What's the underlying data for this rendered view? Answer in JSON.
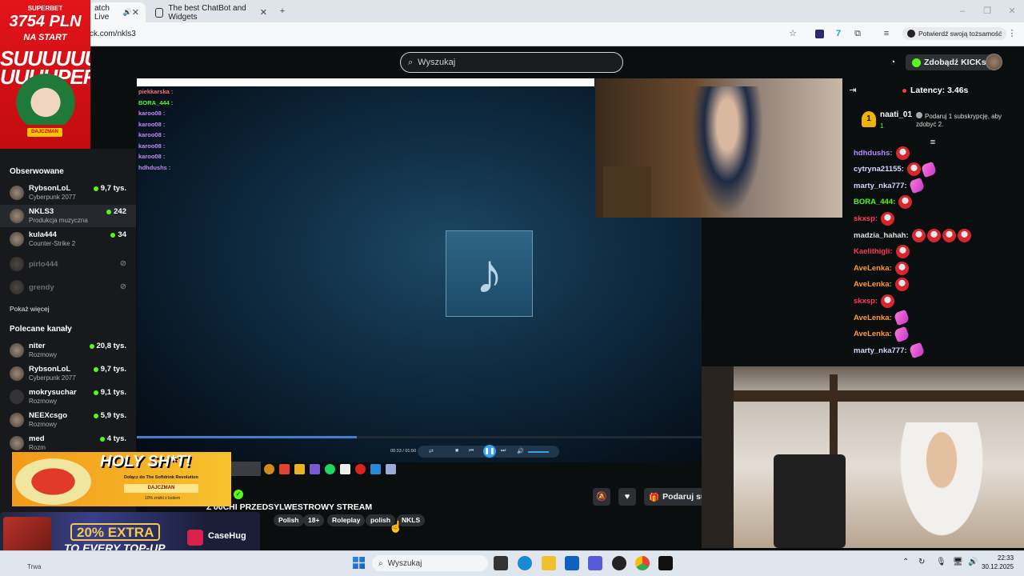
{
  "browser": {
    "tab1_label": "atch Live",
    "tab2_label": "The best ChatBot and Widgets",
    "url": "ck.com/nkls3",
    "verify_label": "Potwierdź swoją tożsamość"
  },
  "left_ad": {
    "brand": "SUPERBET",
    "amount": "3754 PLN",
    "tagline": "NA START",
    "headline": "SUUUUUU UUUUPER",
    "logo": "DAJCZMAN"
  },
  "header": {
    "search_placeholder": "Wyszukaj",
    "kicks_label": "Zdobądź KICKs"
  },
  "sidebar": {
    "followed_title": "Obserwowane",
    "followed": [
      {
        "name": "RybsonLoL",
        "category": "Cyberpunk 2077",
        "viewers": "9,7 tys.",
        "live": true
      },
      {
        "name": "NKLS3",
        "category": "Produkcja muzyczna",
        "viewers": "242",
        "live": true
      },
      {
        "name": "kula444",
        "category": "Counter-Strike 2",
        "viewers": "34",
        "live": true
      },
      {
        "name": "pirlo444",
        "category": "",
        "viewers": "",
        "live": false
      },
      {
        "name": "grendy",
        "category": "",
        "viewers": "",
        "live": false
      }
    ],
    "show_more": "Pokaż więcej",
    "recommended_title": "Polecane kanały",
    "recommended": [
      {
        "name": "niter",
        "category": "Rozmowy",
        "viewers": "20,8 tys."
      },
      {
        "name": "RybsonLoL",
        "category": "Cyberpunk 2077",
        "viewers": "9,7 tys."
      },
      {
        "name": "mokrysuchar",
        "category": "Rozmowy",
        "viewers": "9,1 tys."
      },
      {
        "name": "NEEXcsgo",
        "category": "Rozmowy",
        "viewers": "5,9 tys."
      },
      {
        "name": "med",
        "category": "Rozm",
        "viewers": "4 tys."
      }
    ]
  },
  "overlay_chat": [
    "piekkarska :",
    "BORA_444 :",
    "karoo08 :",
    "karoo08 :",
    "karoo08 :",
    "karoo08 :",
    "karoo08 :",
    "hdhdushs :"
  ],
  "player": {
    "time": "00:33 / 01:50",
    "progress_fraction": 0.39,
    "music_icon": "music-note-icon"
  },
  "stream": {
    "title": "Z'00CHI PRZEDSYLWESTROWY STREAM",
    "tags": [
      "Polish",
      "18+",
      "Roleplay",
      "polish",
      "NKLS"
    ],
    "gift_label": "Podaruj su"
  },
  "chat": {
    "latency": "Latency: 3.46s",
    "top_rank": "1",
    "top_name": "naati_01",
    "top_count": "1",
    "gift_note": "Podaruj 1 subskrypcję, aby zdobyć 2.",
    "messages": [
      {
        "user": "hdhdushs:",
        "color": "#b38cff",
        "emotes": [
          "red"
        ]
      },
      {
        "user": "cytryna21155:",
        "color": "#d7d7ff",
        "emotes": [
          "red",
          "pink"
        ]
      },
      {
        "user": "marty_nka777:",
        "color": "#d7d7ff",
        "emotes": [
          "pink"
        ]
      },
      {
        "user": "BORA_444:",
        "color": "#53fc18",
        "emotes": [
          "red"
        ]
      },
      {
        "user": "skxsp:",
        "color": "#ff3a5a",
        "emotes": [
          "red"
        ]
      },
      {
        "user": "madzia_hahah:",
        "color": "#e0e0e0",
        "emotes": [
          "red",
          "red",
          "red",
          "red"
        ]
      },
      {
        "user": "Kaelithigli:",
        "color": "#ff3a5a",
        "emotes": [
          "red"
        ]
      },
      {
        "user": "AveLenka:",
        "color": "#ff9a2e",
        "emotes": [
          "red"
        ]
      },
      {
        "user": "AveLenka:",
        "color": "#ff9a2e",
        "emotes": [
          "red"
        ]
      },
      {
        "user": "skxsp:",
        "color": "#ff3a5a",
        "emotes": [
          "red"
        ]
      },
      {
        "user": "AveLenka:",
        "color": "#ff9a2e",
        "emotes": [
          "pink"
        ]
      },
      {
        "user": "AveLenka:",
        "color": "#ff9a2e",
        "emotes": [
          "pink"
        ]
      },
      {
        "user": "marty_nka777:",
        "color": "#d7d7ff",
        "emotes": [
          "pink"
        ]
      }
    ]
  },
  "bottom_ad1": {
    "headline": "HOLY SH*T!",
    "sub": "Dołącz do The Softdrink Revolution",
    "pill": "DAJCZMAN",
    "small": "10% zniżki z kodem"
  },
  "bottom_ad2": {
    "pct": "20% EXTRA",
    "line": "TO EVERY TOP-UP",
    "brand": "CaseHug"
  },
  "taskbar": {
    "search_placeholder": "Wyszukaj",
    "weather": "Trwa",
    "time": "22:33",
    "date": "30.12.2025"
  }
}
